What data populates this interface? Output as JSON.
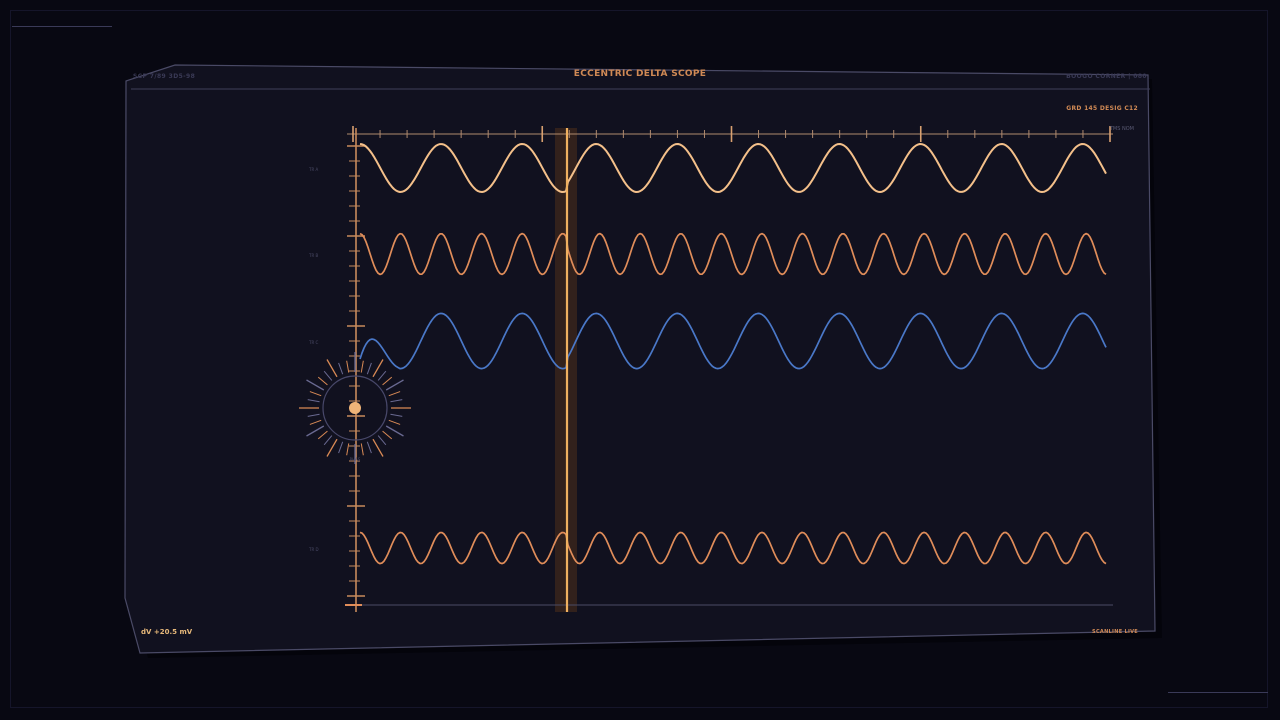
{
  "panel": {
    "title": "ECCENTRIC DELTA SCOPE",
    "header_left": "SCP 7/89 3D5-98",
    "header_right": "BOOGO CORNER | 080",
    "grid_label": "GRD 145  DESIG C12",
    "time_label": "TMS NOM"
  },
  "readouts": {
    "dv": "dV +20.5 mV",
    "status": "SCANLINE LIVE"
  },
  "dial": {
    "label": "PHAS"
  },
  "traces": [
    {
      "label": "TR A",
      "color": "#f4c08a",
      "cycles": 9.2,
      "amplitude": 1.0
    },
    {
      "label": "TR B",
      "color": "#e08d5a",
      "cycles": 18.4,
      "amplitude": 0.85
    },
    {
      "label": "TR C",
      "color": "#4a78c8",
      "cycles": 9.2,
      "amplitude": 1.15
    },
    {
      "label": "TR D",
      "color": "#e08d5a",
      "cycles": 18.4,
      "amplitude": 0.65
    }
  ],
  "colors": {
    "accent": "#d18a55",
    "axis": "#b08a6e",
    "panel_border": "#4a4a66",
    "scanline": "#f0b060"
  }
}
